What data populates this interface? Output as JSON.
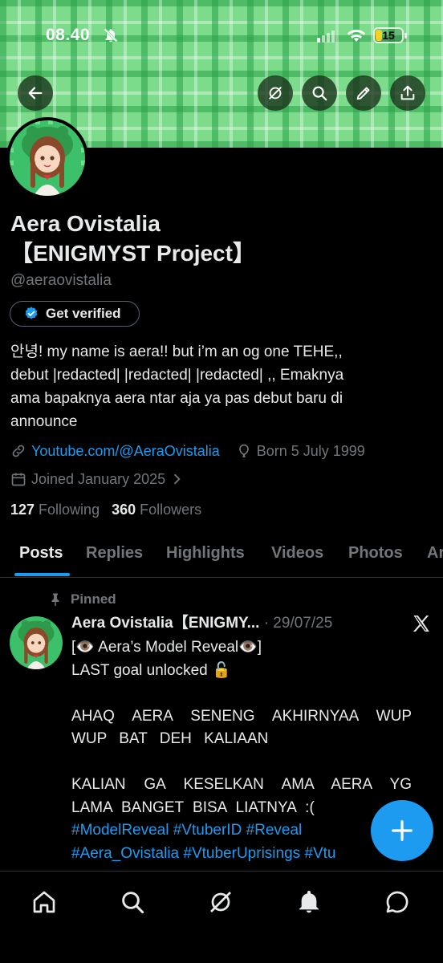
{
  "status_bar": {
    "time": "08.40",
    "battery": "15"
  },
  "profile": {
    "name_line1": "Aera Ovistalia",
    "name_line2": "【ENIGMYST Project】",
    "handle": "@aeraovistalia",
    "verify_label": "Get verified",
    "bio_lines": [
      "안녕! my name is aera!! but i’m an og one TEHE,,",
      "debut |redacted| |redacted| |redacted| ,, Emaknya",
      "ama bapaknya aera ntar aja ya pas debut baru di",
      "announce"
    ],
    "website": "Youtube.com/@AeraOvistalia",
    "birthday": "Born 5 July 1999",
    "joined": "Joined January 2025",
    "following_count": "127",
    "following_label": "Following",
    "followers_count": "360",
    "followers_label": "Followers"
  },
  "tabs": [
    "Posts",
    "Replies",
    "Highlights",
    "Videos",
    "Photos",
    "Ar"
  ],
  "active_tab": "Posts",
  "pinned_post": {
    "pinned_label": "Pinned",
    "author": "Aera Ovistalia【ENIGMY...",
    "date": "· 29/07/25",
    "lines": [
      "[👁️ Aera’s Model Reveal👁️]",
      "LAST goal unlocked 🔓",
      "",
      "AHAQ AERA SENENG AKHIRNYAA WUP",
      "WUP BAT DEH KALIAAN",
      "",
      "KALIAN GA KESELKAN AMA AERA YG",
      "LAMA BANGET BISA LIATNYA :("
    ],
    "hashtags_line1": "#ModelReveal #VtuberID #Reveal",
    "hashtags_line2": "#Aera_Ovistalia #VtuberUprisings #Vtu"
  },
  "icons": [
    "back-arrow-icon",
    "grok-icon",
    "search-icon",
    "edit-icon",
    "share-icon",
    "verified-badge-icon",
    "link-icon",
    "balloon-icon",
    "calendar-icon",
    "chevron-right-icon",
    "pin-icon",
    "x-logo-icon",
    "plus-icon",
    "home-icon",
    "grok-nav-icon",
    "notifications-icon",
    "messages-icon"
  ],
  "colors": {
    "accent": "#1d9bf0",
    "banner": "#7ddc8c",
    "battery": "#f6d21f"
  }
}
